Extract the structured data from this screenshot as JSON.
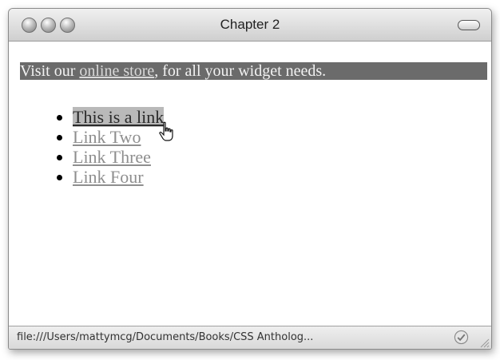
{
  "window": {
    "title": "Chapter 2"
  },
  "banner": {
    "text_before": "Visit our ",
    "link_text": "online store",
    "text_after": ", for all your widget needs."
  },
  "links": [
    {
      "label": "This is a link",
      "state": "hover"
    },
    {
      "label": "Link Two"
    },
    {
      "label": "Link Three"
    },
    {
      "label": "Link Four"
    }
  ],
  "statusbar": {
    "url": "file:///Users/mattymcg/Documents/Books/CSS Antholog..."
  },
  "icons": {
    "status": "check-circle-icon",
    "cursor": "pointer-hand-icon",
    "grip": "resize-grip-icon"
  }
}
